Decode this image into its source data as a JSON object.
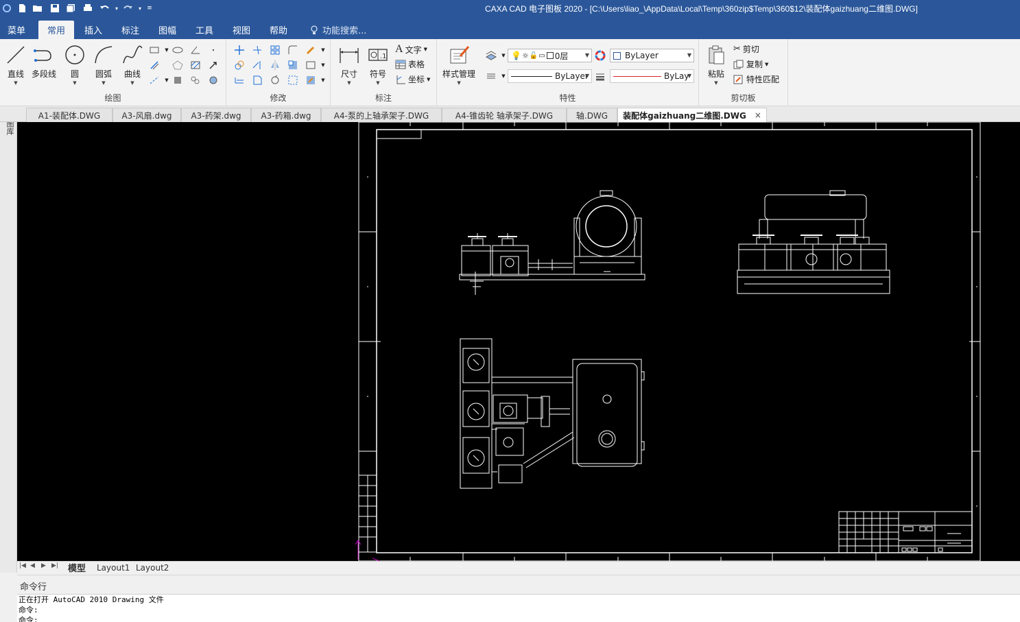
{
  "app": {
    "title": "CAXA CAD 电子图板 2020 - [C:\\Users\\liao_\\AppData\\Local\\Temp\\360zip$Temp\\360$12\\装配体gaizhuang二维图.DWG]"
  },
  "ribbon_tabs": [
    "菜单",
    "常用",
    "插入",
    "标注",
    "图幅",
    "工具",
    "视图",
    "帮助"
  ],
  "active_tab": "常用",
  "search": {
    "placeholder": "功能搜索..."
  },
  "groups": {
    "draw": {
      "label": "绘图",
      "buttons": [
        "直线",
        "多段线",
        "圆",
        "圆弧",
        "曲线"
      ]
    },
    "modify": {
      "label": "修改"
    },
    "annotate": {
      "label": "标注",
      "buttons": [
        "尺寸",
        "符号"
      ],
      "small": [
        "文字",
        "表格",
        "坐标"
      ]
    },
    "properties": {
      "label": "特性",
      "style_button": "样式管理",
      "layer": "0层",
      "color": "ByLayer",
      "linetype": "ByLayer",
      "lineweight": "ByLay"
    },
    "clipboard": {
      "label": "剪切板",
      "paste": "粘贴",
      "small": [
        "剪切",
        "复制",
        "特性匹配"
      ]
    }
  },
  "doc_tabs": [
    "A1-装配体.DWG",
    "A3-风扇.dwg",
    "A3-药架.dwg",
    "A3-药箱.dwg",
    "A4-泵的上轴承架子.DWG",
    "A4-锥齿轮 轴承架子.DWG",
    "轴.DWG",
    "装配体gaizhuang二维图.DWG"
  ],
  "active_doc": "装配体gaizhuang二维图.DWG",
  "left_panel_label": "图库",
  "layout_tabs": [
    "模型",
    "Layout1",
    "Layout2"
  ],
  "active_layout": "模型",
  "command": {
    "header": "命令行",
    "log": [
      "正在打开 AutoCAD 2010 Drawing 文件",
      "命令:",
      "命令:"
    ]
  },
  "colors": {
    "ribbon_blue": "#2b579a",
    "canvas_bg": "#000000",
    "drawing_lines": "#ffffff",
    "linetype_red": "#d62020"
  }
}
